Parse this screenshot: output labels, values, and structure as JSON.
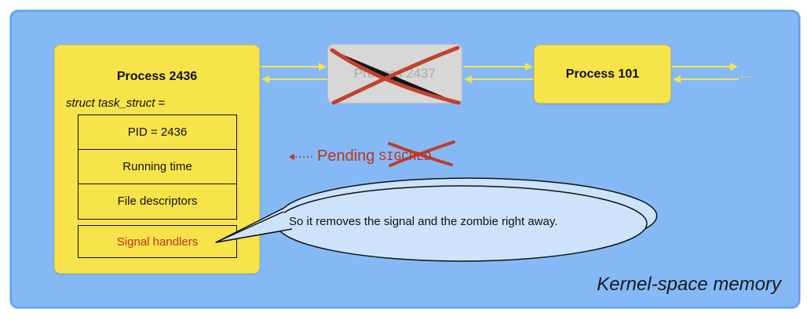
{
  "main_process": {
    "title": "Process 2436",
    "struct_name": "struct task_struct",
    "struct_suffix": " =",
    "fields": [
      "PID = 2436",
      "Running time",
      "File descriptors"
    ],
    "signal_handlers": "Signal handlers"
  },
  "dead_process": {
    "title": "Process 2437"
  },
  "next_process": {
    "title": "Process 101"
  },
  "ellipsis": "...",
  "pending": {
    "label": "Pending",
    "signal": "SIGCHLD"
  },
  "speech_bubble": {
    "text": "So it removes the signal and the zombie right away."
  },
  "region_label": "Kernel-space memory",
  "colors": {
    "kernel_bg": "#85b9f6",
    "process_fill": "#f7e34a",
    "arrow": "#f7e34a",
    "cross": "#c0321b",
    "bubble_fill": "#cde3fb"
  }
}
